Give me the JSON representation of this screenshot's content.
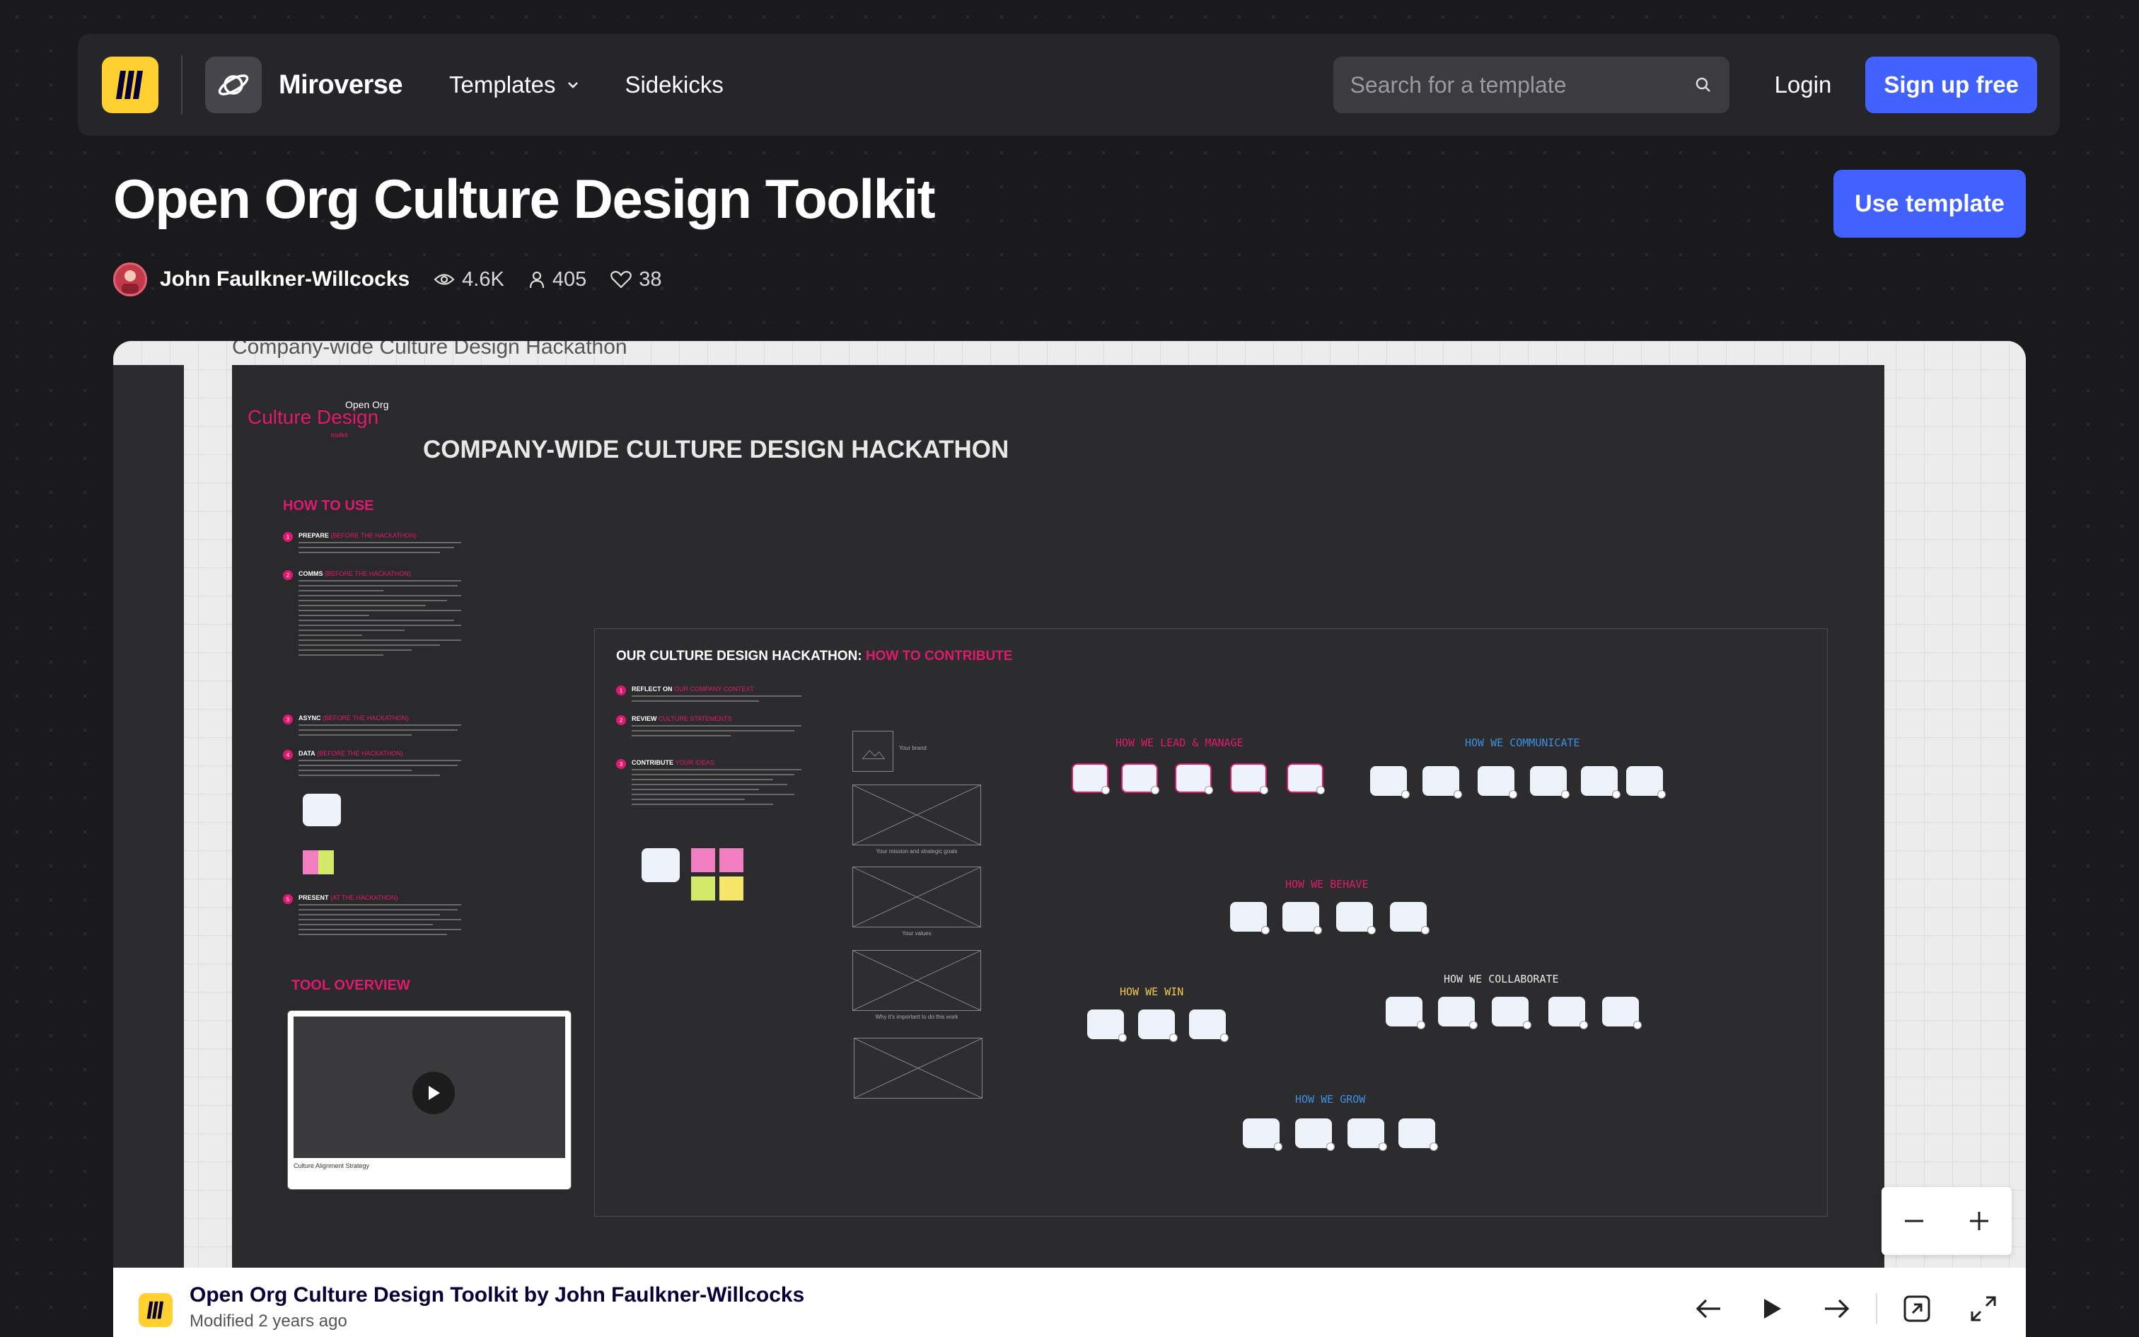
{
  "nav": {
    "brand": "Miroverse",
    "templates_label": "Templates",
    "sidekicks_label": "Sidekicks",
    "search_placeholder": "Search for a template",
    "login_label": "Login",
    "signup_label": "Sign up free",
    "accent": "#4262ff"
  },
  "template": {
    "title": "Open Org Culture Design Toolkit",
    "use_template_label": "Use template",
    "author": "John Faulkner-Willcocks",
    "views": "4.6K",
    "copies": "405",
    "likes": "38"
  },
  "board": {
    "top_label": "Company-wide Culture Design Hackathon",
    "open_org": "Open Org",
    "culture_design": "Culture Design",
    "toolkit": "toolkit",
    "hackathon_title": "COMPANY-WIDE CULTURE DESIGN HACKATHON",
    "how_to_use": "HOW TO USE",
    "tool_overview": "TOOL OVERVIEW",
    "steps": [
      {
        "num": "1",
        "label": "PREPARE",
        "hl": "(BEFORE THE HACKATHON)"
      },
      {
        "num": "2",
        "label": "COMMS",
        "hl": "(BEFORE THE HACKATHON)"
      },
      {
        "num": "3",
        "label": "ASYNC",
        "hl": "(BEFORE THE HACKATHON)"
      },
      {
        "num": "4",
        "label": "DATA",
        "hl": "(BEFORE THE HACKATHON)"
      },
      {
        "num": "5",
        "label": "PRESENT",
        "hl": "(AT THE HACKATHON)"
      }
    ],
    "video_caption": "Culture Alignment Strategy",
    "contribute_title": "OUR CULTURE DESIGN HACKATHON:",
    "contribute_hl": "HOW TO CONTRIBUTE",
    "contribute_steps": [
      {
        "num": "1",
        "label": "REFLECT ON",
        "hl": "OUR COMPANY CONTEXT"
      },
      {
        "num": "2",
        "label": "REVIEW",
        "hl": "CULTURE STATEMENTS"
      },
      {
        "num": "3",
        "label": "CONTRIBUTE",
        "hl": "YOUR IDEAS"
      }
    ],
    "ph_labels": {
      "brand": "Your brand",
      "mission": "Your mission and strategic goals",
      "values": "Your values",
      "why": "Why it's important to do this work"
    },
    "groups": {
      "lead": "HOW WE LEAD & MANAGE",
      "communicate": "HOW WE COMMUNICATE",
      "behave": "HOW WE BEHAVE",
      "win": "HOW WE WIN",
      "collaborate": "HOW WE COLLABORATE",
      "grow": "HOW WE GROW"
    },
    "group_colors": {
      "lead": "#e0196f",
      "communicate": "#3d8fe0",
      "behave": "#e0196f",
      "win": "#f2c94c",
      "collaborate": "#e8e8e8",
      "grow": "#3d8fe0"
    }
  },
  "footer": {
    "title": "Open Org Culture Design Toolkit by John Faulkner-Willcocks",
    "modified": "Modified 2 years ago"
  },
  "icons": [
    "miro-logo-icon",
    "planet-icon",
    "chevron-down-icon",
    "search-icon",
    "eye-icon",
    "user-icon",
    "heart-icon",
    "play-icon",
    "arrow-left-icon",
    "arrow-right-icon",
    "external-link-icon",
    "expand-icon",
    "minus-icon",
    "plus-icon"
  ]
}
